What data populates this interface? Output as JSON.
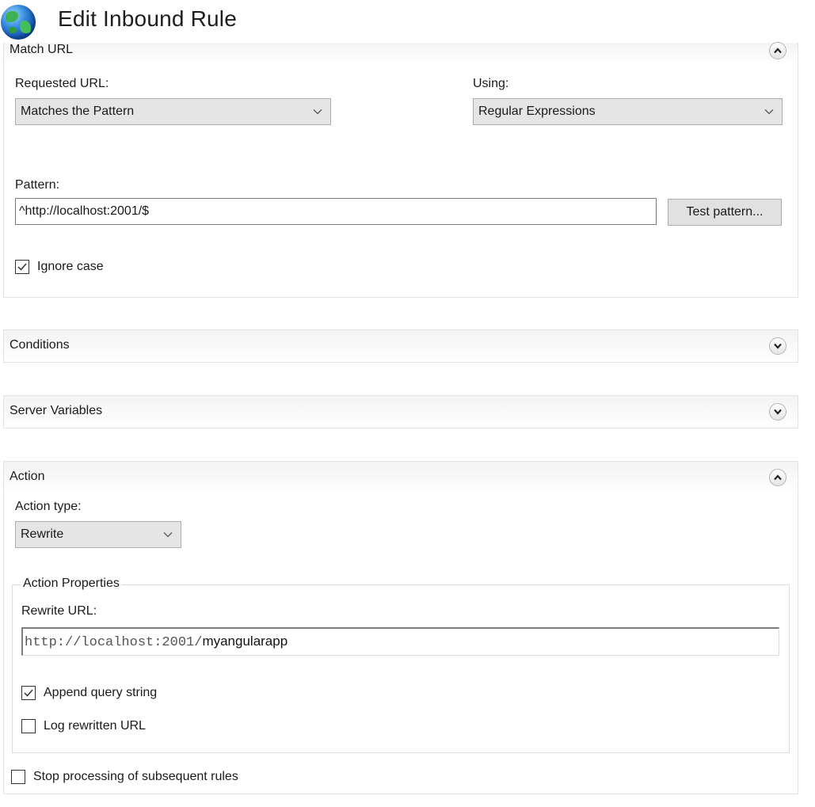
{
  "window": {
    "title": "Edit Inbound Rule",
    "icon": "globe-icon"
  },
  "match_url": {
    "title": "Match URL",
    "expanded": true,
    "requested_url_label": "Requested URL:",
    "requested_url_value": "Matches the Pattern",
    "using_label": "Using:",
    "using_value": "Regular Expressions",
    "pattern_label": "Pattern:",
    "pattern_value": "^http://localhost:2001/$",
    "test_pattern_label": "Test pattern...",
    "ignore_case_label": "Ignore case",
    "ignore_case_checked": true
  },
  "conditions": {
    "title": "Conditions",
    "expanded": false
  },
  "server_variables": {
    "title": "Server Variables",
    "expanded": false
  },
  "action": {
    "title": "Action",
    "expanded": true,
    "action_type_label": "Action type:",
    "action_type_value": "Rewrite",
    "properties_legend": "Action Properties",
    "rewrite_url_label": "Rewrite URL:",
    "rewrite_url_prefix": "http://localhost:2001/",
    "rewrite_url_suffix": "myangularapp",
    "append_query_label": "Append query string",
    "append_query_checked": true,
    "log_rewritten_label": "Log rewritten URL",
    "log_rewritten_checked": false,
    "stop_processing_label": "Stop processing of subsequent rules",
    "stop_processing_checked": false
  }
}
